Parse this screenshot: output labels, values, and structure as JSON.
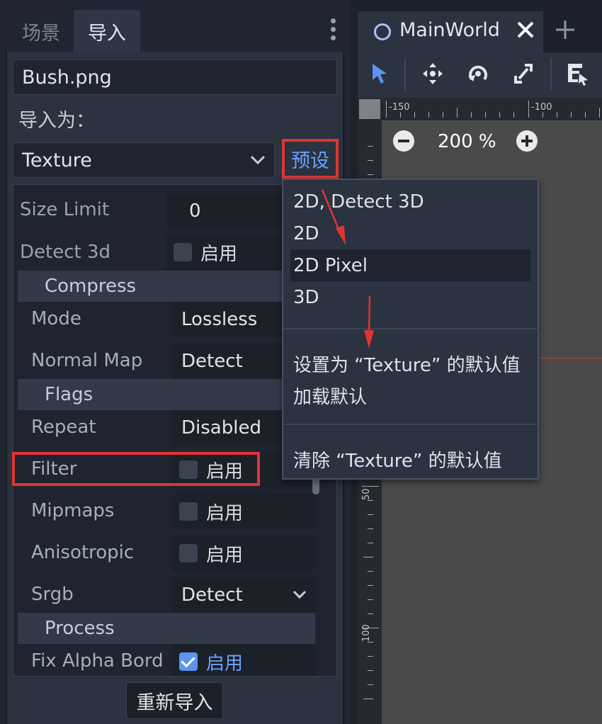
{
  "dock": {
    "tabs": [
      {
        "label": "场景",
        "active": false
      },
      {
        "label": "导入",
        "active": true
      }
    ]
  },
  "import_panel": {
    "filename": "Bush.png",
    "import_as_label": "导入为：",
    "importer": "Texture",
    "preset_label": "预设",
    "reimport_label": "重新导入"
  },
  "inspector": {
    "size_limit": {
      "label": "Size Limit",
      "value": "0"
    },
    "detect_3d": {
      "label": "Detect 3d",
      "check_label": "启用",
      "checked": false
    },
    "compress_section": "Compress",
    "mode": {
      "label": "Mode",
      "value": "Lossless"
    },
    "normal_map": {
      "label": "Normal Map",
      "value": "Detect"
    },
    "flags_section": "Flags",
    "repeat": {
      "label": "Repeat",
      "value": "Disabled"
    },
    "filter": {
      "label": "Filter",
      "check_label": "启用",
      "checked": false
    },
    "mipmaps": {
      "label": "Mipmaps",
      "check_label": "启用",
      "checked": false
    },
    "anisotropic": {
      "label": "Anisotropic",
      "check_label": "启用",
      "checked": false
    },
    "srgb": {
      "label": "Srgb",
      "value": "Detect"
    },
    "process_section": "Process",
    "fix_alpha_border": {
      "label": "Fix Alpha Bord",
      "check_label": "启用",
      "checked": true
    }
  },
  "preset_menu": {
    "items": [
      "2D, Detect 3D",
      "2D",
      "2D Pixel",
      "3D"
    ],
    "hovered": "2D Pixel",
    "set_default": "设置为 “Texture” 的默认值",
    "load_default": "加载默认",
    "clear_default": "清除 “Texture” 的默认值"
  },
  "editor": {
    "scene_tab_title": "MainWorld",
    "zoom_label": "200 %",
    "ruler_h": [
      "-150",
      "-100"
    ],
    "ruler_v": [
      "50",
      "100"
    ]
  },
  "colors": {
    "accent": "#6aa2ff",
    "highlight_box": "#e03434",
    "panel_bg": "#2b3240",
    "field_bg": "#1f2430",
    "viewport_bg": "#4a4a4a"
  }
}
